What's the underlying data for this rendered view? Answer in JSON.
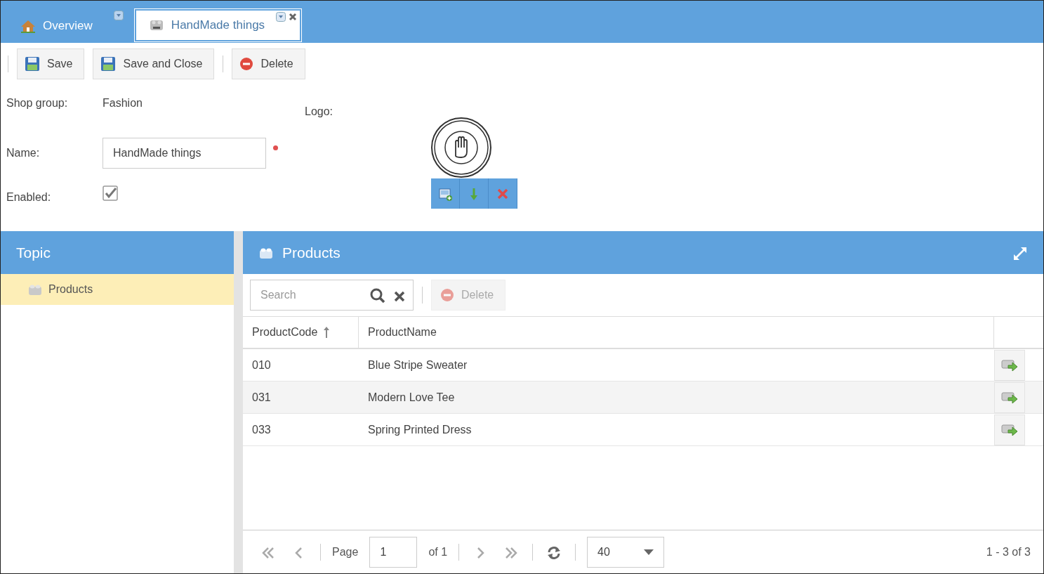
{
  "tabs": [
    {
      "label": "Overview",
      "selected": false,
      "closable": false,
      "kind": "home"
    },
    {
      "label": "HandMade things",
      "selected": true,
      "closable": true,
      "kind": "bricks"
    }
  ],
  "toolbar": [
    {
      "label": "Save",
      "kind": "save"
    },
    {
      "label": "Save and Close",
      "kind": "save"
    },
    {
      "label": "Delete",
      "kind": "delete"
    }
  ],
  "form": {
    "shop_group": {
      "label": "Shop group:",
      "value": "Fashion"
    },
    "name": {
      "label": "Name:",
      "value": "HandMade things",
      "required": true
    },
    "enabled": {
      "label": "Enabled:",
      "checked": true
    },
    "logo": {
      "label": "Logo:"
    }
  },
  "topic_panel": {
    "title": "Topic",
    "items": [
      {
        "label": "Products",
        "selected": true
      }
    ]
  },
  "products_panel": {
    "title": "Products",
    "search": {
      "placeholder": "Search"
    },
    "delete_button": {
      "label": "Delete",
      "disabled": true
    },
    "columns": [
      {
        "label": "ProductCode",
        "sorted": true
      },
      {
        "label": "ProductName",
        "sorted": false
      }
    ],
    "rows": [
      {
        "code": "010",
        "name": "Blue Stripe Sweater"
      },
      {
        "code": "031",
        "name": "Modern Love Tee"
      },
      {
        "code": "033",
        "name": "Spring Printed Dress"
      }
    ],
    "pager": {
      "page_label": "Page",
      "page": "1",
      "of": "of 1",
      "page_size": "40",
      "summary": "1 - 3 of 3"
    }
  }
}
